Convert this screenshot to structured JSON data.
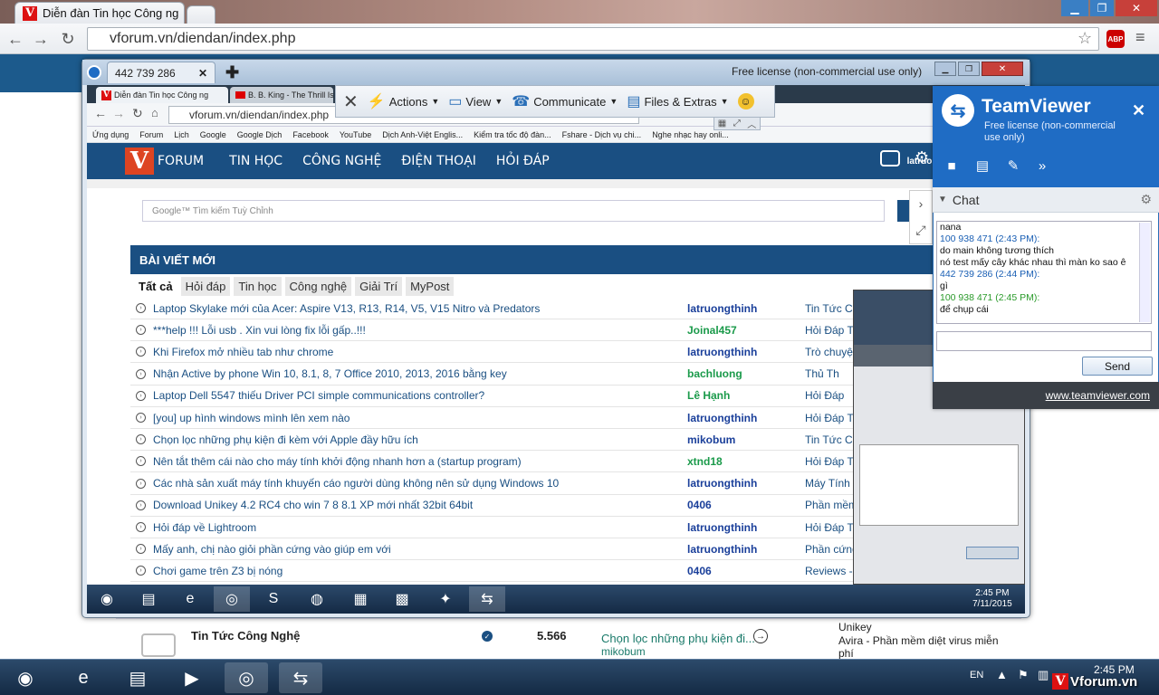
{
  "outer_browser": {
    "tab_title": "Diễn đàn Tin học Công ng",
    "url": "vforum.vn/diendan/index.php",
    "abp_badge": "ABP"
  },
  "teamviewer_remote": {
    "session_tab": "442 739 286",
    "license": "Free license (non-commercial use only)"
  },
  "remote_toolbar": {
    "actions": "Actions",
    "view": "View",
    "communicate": "Communicate",
    "files_extras": "Files & Extras"
  },
  "remote_browser": {
    "tabs": [
      "Diễn đàn Tin học Công ng",
      "B. B. King - The Thrill Is G"
    ],
    "url": "vforum.vn/diendan/index.php",
    "bookmarks": [
      "Ứng dụng",
      "Forum",
      "Lịch",
      "Google",
      "Google Dịch",
      "Facebook",
      "YouTube",
      "Dịch Anh-Việt Englis...",
      "Kiểm tra tốc độ đàn...",
      "Fshare - Dịch vụ chi...",
      "Nghe nhạc hay onli..."
    ]
  },
  "site": {
    "nav": [
      "FORUM",
      "TIN HỌC",
      "CÔNG NGHỆ",
      "ĐIỆN THOẠI",
      "HỎI ĐÁP"
    ],
    "user": "latruongthinh",
    "search_placeholder": "Google™ Tìm kiếm Tuỳ Chỉnh",
    "section_heading": "BÀI VIẾT MỚI",
    "filters": [
      "Tất cả",
      "Hỏi đáp",
      "Tin học",
      "Công nghệ",
      "Giải Trí",
      "MyPost"
    ],
    "posts": [
      {
        "title": "Laptop Skylake mới của Acer: Aspire V13, R13, R14, V5, V15 Nitro và Predators",
        "user": "latruongthinh",
        "user_color": "#1a3f9a",
        "cat": "Tin Tức Cô"
      },
      {
        "title": "***help !!! Lỗi usb . Xin vui lòng fix lỗi gấp..!!!",
        "user": "Joinal457",
        "user_color": "#1a9a4a",
        "cat": "Hỏi Đáp Ti"
      },
      {
        "title": "Khi Firefox mở nhiều tab như chrome",
        "user": "latruongthinh",
        "user_color": "#1a3f9a",
        "cat": "Trò chuyệ"
      },
      {
        "title": "Nhận Active by phone Win 10, 8.1, 8, 7 Office 2010, 2013, 2016 bằng key",
        "user": "bachluong",
        "user_color": "#1a9a4a",
        "cat": "Thủ Th"
      },
      {
        "title": "Laptop Dell 5547 thiếu Driver PCI simple communications controller?",
        "user": "Lê Hạnh",
        "user_color": "#1a9a4a",
        "cat": "Hỏi Đáp"
      },
      {
        "title": "[you] up hình windows mình lên xem nào",
        "user": "latruongthinh",
        "user_color": "#1a3f9a",
        "cat": "Hỏi Đáp Ti"
      },
      {
        "title": "Chọn lọc những phụ kiện đi kèm với Apple đầy hữu ích",
        "user": "mikobum",
        "user_color": "#1a3f9a",
        "cat": "Tin Tức Cô"
      },
      {
        "title": "Nên tắt thêm cái nào cho máy tính khởi động nhanh hơn a (startup program)",
        "user": "xtnd18",
        "user_color": "#1a9a4a",
        "cat": "Hỏi Đáp Ti"
      },
      {
        "title": "Các nhà sản xuất máy tính khuyến cáo người dùng không nên sử dụng Windows 10",
        "user": "latruongthinh",
        "user_color": "#1a3f9a",
        "cat": "Máy Tính -"
      },
      {
        "title": "Download Unikey 4.2 RC4 cho win 7 8 8.1 XP mới nhất 32bit 64bit",
        "user": "0406",
        "user_color": "#1a3f9a",
        "cat": "Phần mềm"
      },
      {
        "title": "Hỏi đáp về Lightroom",
        "user": "latruongthinh",
        "user_color": "#1a3f9a",
        "cat": "Hỏi Đáp Ti"
      },
      {
        "title": "Mấy anh, chị nào giỏi phần cứng vào giúp em với",
        "user": "latruongthinh",
        "user_color": "#1a3f9a",
        "cat": "Phần cứng"
      },
      {
        "title": "Chơi game trên Z3 bị nóng",
        "user": "0406",
        "user_color": "#1a3f9a",
        "cat": "Reviews -"
      }
    ],
    "remote_clock": {
      "time": "2:45 PM",
      "date": "7/11/2015"
    }
  },
  "outer_page_bottom": {
    "forum_name": "Tin Tức Công Nghệ",
    "count": "5.566",
    "latest": "Chọn lọc những phụ kiện đi...",
    "latest_user": "mikobum",
    "side1": "Unikey",
    "side2": "Avira - Phần mềm diệt virus miễn phí"
  },
  "tv_panel": {
    "title": "TeamViewer",
    "subtitle": "Free license (non-commercial use only)",
    "chat_header": "Chat",
    "messages": [
      {
        "text": "nana",
        "color": "#111"
      },
      {
        "text": "100 938 471 (2:43 PM):",
        "color": "#1a5fb4"
      },
      {
        "text": "do main không tương thích",
        "color": "#111"
      },
      {
        "text": "nó test mấy cây khác nhau thì màn ko sao ê",
        "color": "#111"
      },
      {
        "text": "442 739 286 (2:44 PM):",
        "color": "#1a5fb4"
      },
      {
        "text": "gì",
        "color": "#111"
      },
      {
        "text": "100 938 471 (2:45 PM):",
        "color": "#2a9a2a"
      },
      {
        "text": "để chụp cái",
        "color": "#111"
      }
    ],
    "send": "Send",
    "link": "www.teamviewer.com"
  },
  "taskbar": {
    "lang": "EN",
    "time": "2:45 PM",
    "watermark": "Vforum.vn"
  }
}
